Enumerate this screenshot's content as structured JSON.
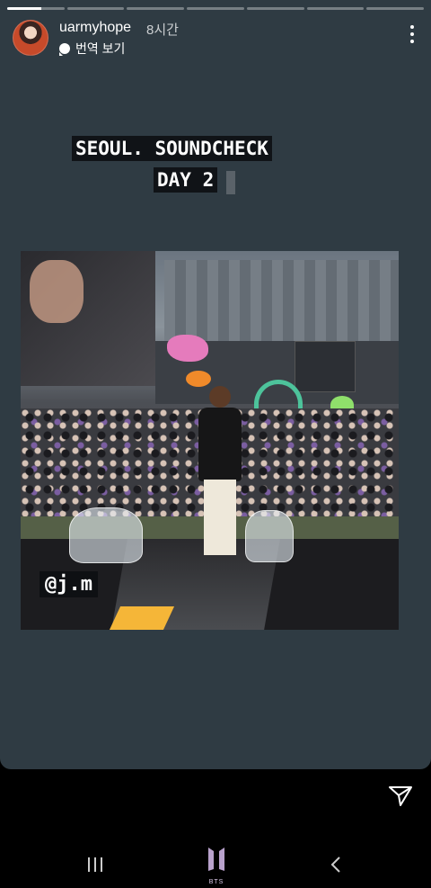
{
  "header": {
    "username": "uarmyhope",
    "time": "8시간",
    "translate_label": "번역 보기",
    "progress_segments": 7,
    "active_segment": 0
  },
  "story": {
    "caption_line1": "SEOUL. SOUNDCHECK",
    "caption_line2": "DAY 2",
    "mention": "@j.m"
  },
  "bottom": {
    "send_icon": "paper-plane-icon"
  },
  "navbar": {
    "home_logo_text": "BTS",
    "icons": [
      "recent-apps-icon",
      "home-bts-logo-icon",
      "back-icon"
    ]
  },
  "colors": {
    "story_background": "#2f3b43",
    "page_background": "#000000",
    "caption_background": "#101317"
  }
}
